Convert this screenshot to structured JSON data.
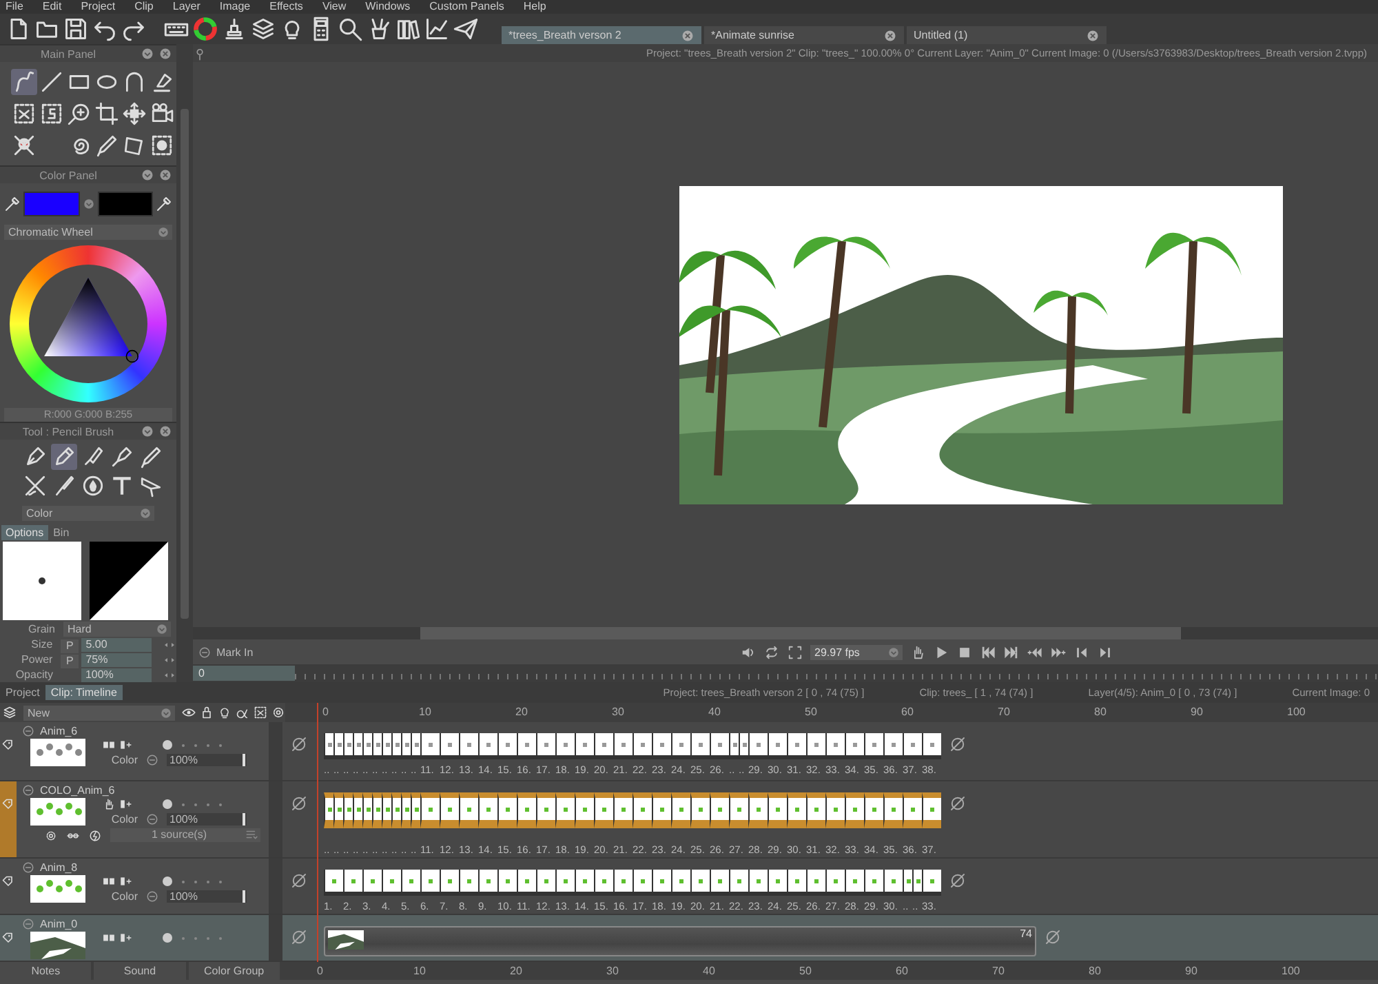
{
  "menu": [
    "File",
    "Edit",
    "Project",
    "Clip",
    "Layer",
    "Image",
    "Effects",
    "View",
    "Windows",
    "Custom Panels",
    "Help"
  ],
  "documents": [
    {
      "title": "*trees_Breath verson 2",
      "selected": true
    },
    {
      "title": "*Animate sunrise",
      "selected": false
    },
    {
      "title": "Untitled (1)",
      "selected": false
    }
  ],
  "info_line": "Project:  \"trees_Breath version 2\"  Clip: \"trees_\"   100.00%   0°   Current Layer: \"Anim_0\"   Current Image: 0 (/Users/s3763983/Desktop/trees_Breath version 2.tvpp)",
  "main_panel": {
    "title": "Main Panel",
    "tools": [
      {
        "selected": true
      },
      {
        "selected": false
      },
      {
        "selected": false
      },
      {
        "selected": false
      },
      {
        "selected": false
      },
      {
        "selected": false
      },
      {
        "selected": false
      },
      {
        "selected": false
      },
      {
        "selected": false
      },
      {
        "selected": false
      },
      {
        "selected": false
      },
      {
        "selected": false
      },
      {
        "selected": false
      },
      {
        "selected": false
      },
      {
        "selected": false
      },
      {
        "selected": false
      },
      {
        "selected": false
      }
    ]
  },
  "color_panel": {
    "title": "Color Panel",
    "swatches": [
      {
        "color": "#1a00ff"
      },
      {
        "color": "#000000"
      }
    ],
    "mode": "Chromatic Wheel",
    "readout": "R:000 G:000 B:255"
  },
  "tool_panel": {
    "title": "Tool : Pencil Brush",
    "tools": [
      {
        "selected": false
      },
      {
        "selected": true
      },
      {
        "selected": false
      },
      {
        "selected": false
      },
      {
        "selected": false
      },
      {
        "selected": false
      },
      {
        "selected": false
      },
      {
        "selected": false
      },
      {
        "selected": false
      },
      {
        "selected": false
      }
    ],
    "mode": "Color",
    "tabs": [
      {
        "label": "Options",
        "selected": true
      },
      {
        "label": "Bin",
        "selected": false
      }
    ],
    "grain": {
      "label": "Grain",
      "value": "Hard"
    },
    "params": [
      {
        "label": "Size",
        "pressure": "P",
        "value": "5.00"
      },
      {
        "label": "Power",
        "pressure": "P",
        "value": "75%"
      },
      {
        "label": "Opacity",
        "value": "100%"
      }
    ]
  },
  "player": {
    "mark_in": "Mark In",
    "frame": "0",
    "fps": "29.97 fps"
  },
  "timeline": {
    "tabs": [
      {
        "label": "Project",
        "selected": false
      },
      {
        "label": "Clip: Timeline",
        "selected": true
      }
    ],
    "info": [
      "Project: trees_Breath verson 2 [ 0 , 74  (75) ]",
      "Clip: trees_ [ 1 , 74  (74) ]",
      "Layer(4/5): Anim_0 [ 0 , 73  (74) ]",
      "Current Image: 0"
    ],
    "new_menu": "New",
    "ruler": [
      "0",
      "10",
      "20",
      "30",
      "40",
      "50",
      "60",
      "70",
      "80",
      "90",
      "100"
    ],
    "layers": [
      {
        "name": "Anim_6",
        "selected": false,
        "blend": "Color",
        "opacity": "100%",
        "level": 1,
        "frames": [
          {
            "label": "..",
            "kind": "single"
          },
          {
            "label": "..",
            "kind": "single"
          },
          {
            "label": "..",
            "kind": "single"
          },
          {
            "label": "..",
            "kind": "single"
          },
          {
            "label": "..",
            "kind": "single"
          },
          {
            "label": "..",
            "kind": "single"
          },
          {
            "label": "..",
            "kind": "single"
          },
          {
            "label": "..",
            "kind": "single"
          },
          {
            "label": "..",
            "kind": "single"
          },
          {
            "label": "..",
            "kind": "single"
          },
          {
            "label": "11.",
            "kind": "double"
          },
          {
            "label": "12.",
            "kind": "double"
          },
          {
            "label": "13.",
            "kind": "double"
          },
          {
            "label": "14.",
            "kind": "double"
          },
          {
            "label": "15.",
            "kind": "double"
          },
          {
            "label": "16.",
            "kind": "double"
          },
          {
            "label": "17.",
            "kind": "double"
          },
          {
            "label": "18.",
            "kind": "double"
          },
          {
            "label": "19.",
            "kind": "double"
          },
          {
            "label": "20.",
            "kind": "double"
          },
          {
            "label": "21.",
            "kind": "double"
          },
          {
            "label": "22.",
            "kind": "double"
          },
          {
            "label": "23.",
            "kind": "double"
          },
          {
            "label": "24.",
            "kind": "double"
          },
          {
            "label": "25.",
            "kind": "double"
          },
          {
            "label": "26.",
            "kind": "double"
          },
          {
            "label": "..",
            "kind": "single"
          },
          {
            "label": "..",
            "kind": "single"
          },
          {
            "label": "29.",
            "kind": "double"
          },
          {
            "label": "30.",
            "kind": "double"
          },
          {
            "label": "31.",
            "kind": "double"
          },
          {
            "label": "32.",
            "kind": "double"
          },
          {
            "label": "33.",
            "kind": "double"
          },
          {
            "label": "34.",
            "kind": "double"
          },
          {
            "label": "35.",
            "kind": "double"
          },
          {
            "label": "36.",
            "kind": "double"
          },
          {
            "label": "37.",
            "kind": "double"
          },
          {
            "label": "38.",
            "kind": "double"
          }
        ]
      },
      {
        "name": "COLO_Anim_6",
        "selected": true,
        "blend": "Color",
        "opacity": "100%",
        "level": 1,
        "sources": "1 source(s)",
        "frames": [
          {
            "label": "..",
            "kind": "single"
          },
          {
            "label": "..",
            "kind": "single"
          },
          {
            "label": "..",
            "kind": "single"
          },
          {
            "label": "..",
            "kind": "single"
          },
          {
            "label": "..",
            "kind": "single"
          },
          {
            "label": "..",
            "kind": "single"
          },
          {
            "label": "..",
            "kind": "single"
          },
          {
            "label": "..",
            "kind": "single"
          },
          {
            "label": "..",
            "kind": "single"
          },
          {
            "label": "..",
            "kind": "single"
          },
          {
            "label": "11.",
            "kind": "double"
          },
          {
            "label": "12.",
            "kind": "double"
          },
          {
            "label": "13.",
            "kind": "double"
          },
          {
            "label": "14.",
            "kind": "double"
          },
          {
            "label": "15.",
            "kind": "double"
          },
          {
            "label": "16.",
            "kind": "double"
          },
          {
            "label": "17.",
            "kind": "double"
          },
          {
            "label": "18.",
            "kind": "double"
          },
          {
            "label": "19.",
            "kind": "double"
          },
          {
            "label": "20.",
            "kind": "double"
          },
          {
            "label": "21.",
            "kind": "double"
          },
          {
            "label": "22.",
            "kind": "double"
          },
          {
            "label": "23.",
            "kind": "double"
          },
          {
            "label": "24.",
            "kind": "double"
          },
          {
            "label": "25.",
            "kind": "double"
          },
          {
            "label": "26.",
            "kind": "double"
          },
          {
            "label": "27.",
            "kind": "double"
          },
          {
            "label": "28.",
            "kind": "double"
          },
          {
            "label": "29.",
            "kind": "double"
          },
          {
            "label": "30.",
            "kind": "double"
          },
          {
            "label": "31.",
            "kind": "double"
          },
          {
            "label": "32.",
            "kind": "double"
          },
          {
            "label": "33.",
            "kind": "double"
          },
          {
            "label": "34.",
            "kind": "double"
          },
          {
            "label": "35.",
            "kind": "double"
          },
          {
            "label": "36.",
            "kind": "double"
          },
          {
            "label": "37.",
            "kind": "double"
          }
        ]
      },
      {
        "name": "Anim_8",
        "selected": false,
        "blend": "Color",
        "opacity": "100%",
        "level": 1,
        "frames": [
          {
            "label": "1.",
            "kind": "double"
          },
          {
            "label": "2.",
            "kind": "double"
          },
          {
            "label": "3.",
            "kind": "double"
          },
          {
            "label": "4.",
            "kind": "double"
          },
          {
            "label": "5.",
            "kind": "double"
          },
          {
            "label": "6.",
            "kind": "double"
          },
          {
            "label": "7.",
            "kind": "double"
          },
          {
            "label": "8.",
            "kind": "double"
          },
          {
            "label": "9.",
            "kind": "double"
          },
          {
            "label": "10.",
            "kind": "double"
          },
          {
            "label": "11.",
            "kind": "double"
          },
          {
            "label": "12.",
            "kind": "double"
          },
          {
            "label": "13.",
            "kind": "double"
          },
          {
            "label": "14.",
            "kind": "double"
          },
          {
            "label": "15.",
            "kind": "double"
          },
          {
            "label": "16.",
            "kind": "double"
          },
          {
            "label": "17.",
            "kind": "double"
          },
          {
            "label": "18.",
            "kind": "double"
          },
          {
            "label": "19.",
            "kind": "double"
          },
          {
            "label": "20.",
            "kind": "double"
          },
          {
            "label": "21.",
            "kind": "double"
          },
          {
            "label": "22.",
            "kind": "double"
          },
          {
            "label": "23.",
            "kind": "double"
          },
          {
            "label": "24.",
            "kind": "double"
          },
          {
            "label": "25.",
            "kind": "double"
          },
          {
            "label": "26.",
            "kind": "double"
          },
          {
            "label": "27.",
            "kind": "double"
          },
          {
            "label": "28.",
            "kind": "double"
          },
          {
            "label": "29.",
            "kind": "double"
          },
          {
            "label": "30.",
            "kind": "double"
          },
          {
            "label": "..",
            "kind": "single"
          },
          {
            "label": "..",
            "kind": "single"
          },
          {
            "label": "33.",
            "kind": "double"
          }
        ]
      },
      {
        "name": "Anim_0",
        "selected": false,
        "clip_length": "74"
      }
    ],
    "bottom_tabs": [
      "Notes",
      "Sound",
      "Color Group"
    ],
    "bottom_ruler": [
      "0",
      "10",
      "20",
      "30",
      "40",
      "50",
      "60",
      "70",
      "80",
      "90",
      "100"
    ]
  }
}
